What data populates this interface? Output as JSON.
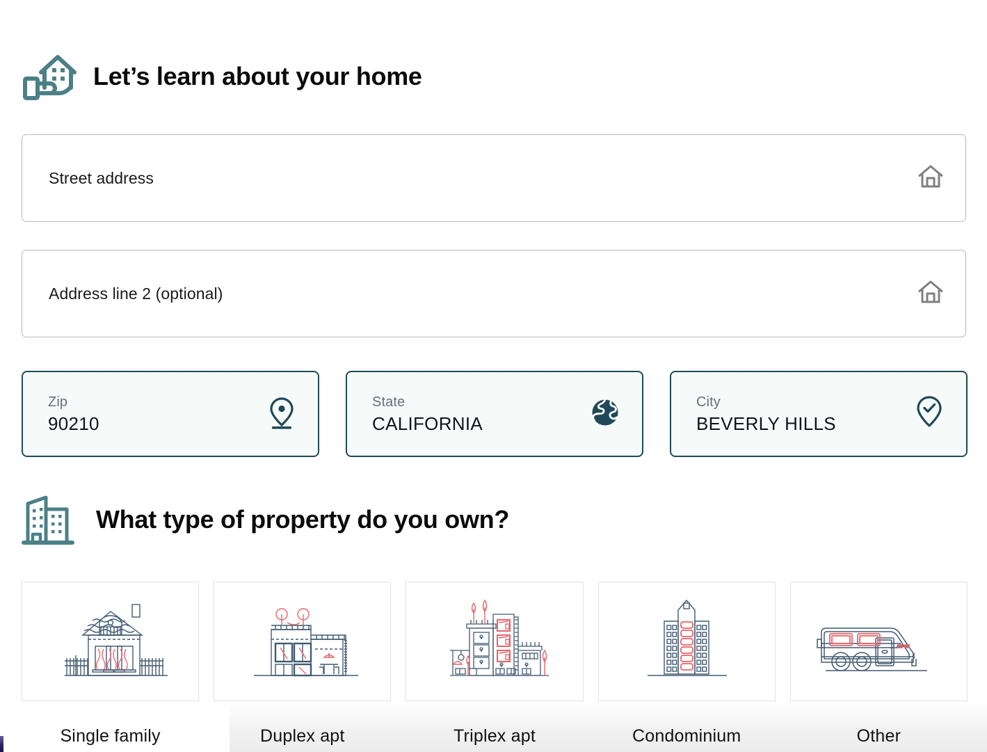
{
  "colors": {
    "heading_icon_teal": "#4c8086",
    "field_border_gray": "#b9b9b9",
    "loc_border_teal": "#1f4a55",
    "loc_background": "#f6fbfa",
    "illustration_blue": "#415a72",
    "illustration_red": "#e8636a",
    "text_dark": "#0b0b0b",
    "label_gray": "#63707a"
  },
  "home_section": {
    "icon": "house-in-hand-icon",
    "title": "Let’s learn about your home",
    "fields": [
      {
        "name": "street-address",
        "placeholder": "Street address",
        "value": "",
        "icon": "home-outline-icon"
      },
      {
        "name": "address-line-2",
        "placeholder": "Address line 2 (optional)",
        "value": "",
        "icon": "home-outline-icon"
      }
    ],
    "location_fields": [
      {
        "name": "zip",
        "label": "Zip",
        "value": "90210",
        "icon": "map-pin-icon"
      },
      {
        "name": "state",
        "label": "State",
        "value": "CALIFORNIA",
        "icon": "globe-icon"
      },
      {
        "name": "city",
        "label": "City",
        "value": "BEVERLY HILLS",
        "icon": "map-pin-check-icon"
      }
    ]
  },
  "property_section": {
    "icon": "office-buildings-icon",
    "title": "What type of property do you own?",
    "options": [
      {
        "name": "single-family",
        "label": "Single family",
        "illustration": "single-family-house-illustration"
      },
      {
        "name": "duplex-apt",
        "label": "Duplex apt",
        "illustration": "duplex-building-illustration"
      },
      {
        "name": "triplex-apt",
        "label": "Triplex apt",
        "illustration": "triplex-building-illustration"
      },
      {
        "name": "condominium",
        "label": "Condominium",
        "illustration": "condo-tower-illustration"
      },
      {
        "name": "other",
        "label": "Other",
        "illustration": "rv-trailer-illustration"
      }
    ]
  }
}
